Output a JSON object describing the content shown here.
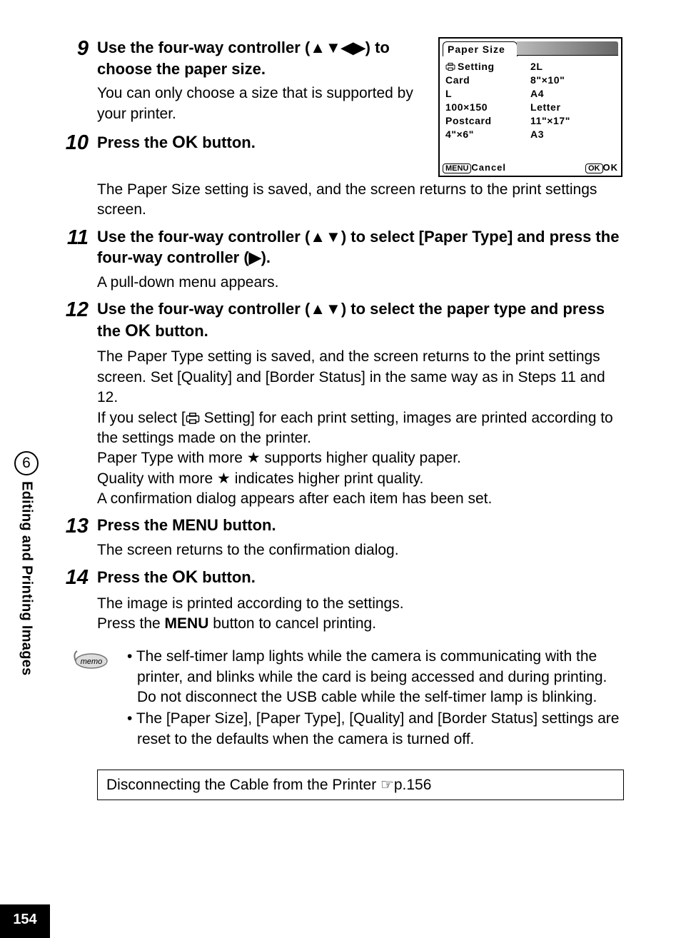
{
  "pageNumber": "154",
  "sideTab": {
    "chapter": "6",
    "title": "Editing and Printing Images"
  },
  "lcd": {
    "title": "Paper Size",
    "leftCol": [
      "Setting",
      "Card",
      "L",
      "100×150",
      "Postcard",
      "4\"×6\""
    ],
    "rightCol": [
      "2L",
      "8\"×10\"",
      "A4",
      "Letter",
      "11\"×17\"",
      "A3"
    ],
    "footer": {
      "menuLabel": "MENU",
      "cancel": "Cancel",
      "okBtn": "OK",
      "ok": "OK"
    }
  },
  "steps": {
    "s9": {
      "num": "9",
      "headA": "Use the four-way controller (",
      "headB": ") to choose the paper size.",
      "desc": "You can only choose a size that is supported by your printer."
    },
    "s10": {
      "num": "10",
      "headA": "Press the ",
      "ok": "OK",
      "headB": " button.",
      "desc": "The Paper Size setting is saved, and the screen returns to the print settings screen."
    },
    "s11": {
      "num": "11",
      "headA": "Use the four-way controller (",
      "headB": ") to select [Paper Type] and press the four-way controller (",
      "headC": ").",
      "desc": "A pull-down menu appears."
    },
    "s12": {
      "num": "12",
      "headA": "Use the four-way controller (",
      "headB": ") to select the paper type and press the ",
      "ok": "OK",
      "headC": " button.",
      "desc1": "The Paper Type setting is saved, and the screen returns to the print settings screen. Set [Quality] and [Border Status] in the same way as in Steps 11 and 12.",
      "desc2a": "If you select [",
      "desc2b": " Setting] for each print setting, images are printed according to the settings made on the printer.",
      "desc3": "Paper Type with more ★ supports higher quality paper.",
      "desc4": "Quality with more ★ indicates higher print quality.",
      "desc5": "A confirmation dialog appears after each item has been set."
    },
    "s13": {
      "num": "13",
      "headA": "Press the ",
      "menu": "MENU",
      "headB": " button.",
      "desc": "The screen returns to the confirmation dialog."
    },
    "s14": {
      "num": "14",
      "headA": "Press the ",
      "ok": "OK",
      "headB": " button.",
      "desc1": "The image is printed according to the settings.",
      "desc2a": "Press the ",
      "menu": "MENU",
      "desc2b": " button to cancel printing."
    }
  },
  "memo": {
    "label": "memo",
    "b1": "The self-timer lamp lights while the camera is communicating with the printer, and blinks while the card is being accessed and during printing. Do not disconnect the USB cable while the self-timer lamp is blinking.",
    "b2": "The [Paper Size], [Paper Type], [Quality] and [Border Status] settings are reset to the defaults when the camera is turned off."
  },
  "xref": {
    "text": "Disconnecting the Cable from the Printer ",
    "page": "p.156"
  }
}
